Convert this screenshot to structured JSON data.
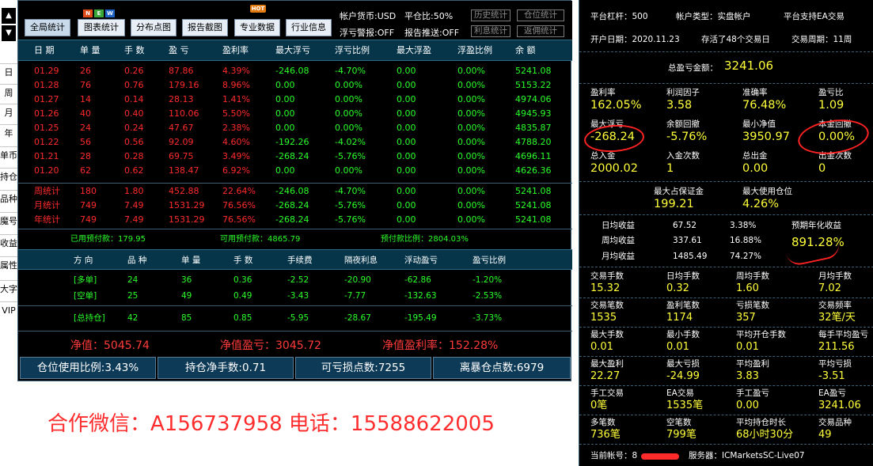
{
  "nav": {
    "up": "▲",
    "down": "▼",
    "items": [
      "日",
      "周",
      "月",
      "年",
      "单币",
      "持仓",
      "品种",
      "魔号",
      "收益",
      "属性",
      "大字",
      "VIP"
    ]
  },
  "toolbar": {
    "buttons": [
      "全局统计",
      "图表统计",
      "分布点图",
      "报告截图",
      "专业数据",
      "行业信息"
    ],
    "badge_new": [
      "N",
      "E",
      "W"
    ],
    "badge_hot": "HOT",
    "account_currency_label": "帐户货币:USD",
    "ratio_label": "平仓比:50%",
    "float_alarm": "浮亏警报:OFF",
    "report_push": "报告推送:OFF",
    "small_buttons": [
      "历史统计",
      "仓位统计",
      "利息统计",
      "返佣统计"
    ]
  },
  "table1": {
    "headers": [
      "日 期",
      "单 量",
      "手 数",
      "盈 亏",
      "盈利率",
      "最大浮亏",
      "浮亏比例",
      "最大浮盈",
      "浮盈比例",
      "余 额"
    ],
    "rows": [
      [
        "01.29",
        "26",
        "0.26",
        "87.86",
        "4.39%",
        "-246.08",
        "-4.70%",
        "0.00",
        "0.00%",
        "5241.08"
      ],
      [
        "01.28",
        "76",
        "0.76",
        "179.16",
        "8.96%",
        "0.00",
        "0.00%",
        "0.00",
        "0.00%",
        "5153.22"
      ],
      [
        "01.27",
        "14",
        "0.14",
        "28.13",
        "1.41%",
        "0.00",
        "0.00%",
        "0.00",
        "0.00%",
        "4974.06"
      ],
      [
        "01.26",
        "40",
        "0.40",
        "110.06",
        "5.50%",
        "0.00",
        "0.00%",
        "0.00",
        "0.00%",
        "4945.93"
      ],
      [
        "01.25",
        "24",
        "0.24",
        "47.67",
        "2.38%",
        "0.00",
        "0.00%",
        "0.00",
        "0.00%",
        "4835.87"
      ],
      [
        "01.22",
        "56",
        "0.56",
        "92.09",
        "4.60%",
        "-192.26",
        "-4.02%",
        "0.00",
        "0.00%",
        "4788.20"
      ],
      [
        "01.21",
        "28",
        "0.28",
        "69.75",
        "3.49%",
        "-268.24",
        "-5.76%",
        "0.00",
        "0.00%",
        "4696.11"
      ],
      [
        "01.20",
        "62",
        "0.62",
        "138.47",
        "6.92%",
        "0.00",
        "0.00%",
        "0.00",
        "0.00%",
        "4626.36"
      ]
    ],
    "summary": [
      [
        "周统计",
        "180",
        "1.80",
        "452.88",
        "22.64%",
        "-246.08",
        "-4.70%",
        "0.00",
        "0.00%",
        "5241.08"
      ],
      [
        "月统计",
        "749",
        "7.49",
        "1531.29",
        "76.56%",
        "-268.24",
        "-5.76%",
        "0.00",
        "0.00%",
        "5241.08"
      ],
      [
        "年统计",
        "749",
        "7.49",
        "1531.29",
        "76.56%",
        "-268.24",
        "-5.76%",
        "0.00",
        "0.00%",
        "5241.08"
      ]
    ]
  },
  "margin": {
    "used": "已用预付款：179.95",
    "available": "可用预付款：4865.79",
    "ratio": "预付款比例：2804.03%"
  },
  "table2": {
    "headers": [
      "方 向",
      "品 种",
      "单 量",
      "手 数",
      "手续费",
      "隔夜利息",
      "浮动盈亏",
      "盈亏比例"
    ],
    "rows": [
      [
        "[多单]",
        "24",
        "36",
        "0.36",
        "-2.52",
        "-20.90",
        "-62.86",
        "-1.20%"
      ],
      [
        "[空单]",
        "25",
        "49",
        "0.49",
        "-3.43",
        "-7.77",
        "-132.63",
        "-2.53%"
      ],
      [
        "[总持仓]",
        "42",
        "85",
        "0.85",
        "-5.95",
        "-28.67",
        "-195.49",
        "-3.73%"
      ]
    ]
  },
  "net": {
    "equity": "净值：5045.74",
    "equity_pl": "净值盈亏：3045.72",
    "equity_rate": "净值盈利率：152.28%"
  },
  "bottom": [
    "仓位使用比例:3.43%",
    "持仓净手数:0.71",
    "可亏损点数:7255",
    "离暴仓点数:6979"
  ],
  "contact": "合作微信：A156737958  电话：15588622005",
  "right": {
    "leverage": "平台杠杆：500",
    "acct_type": "帐户类型：实盘帐户",
    "ea_support": "平台支持EA交易",
    "open_date": "开户日期：2020.11.23",
    "survived": "存活了48个交易日",
    "cycle": "交易周期：11周",
    "total_pl_label": "总盈亏金额：",
    "total_pl": "3241.06",
    "grid1": [
      {
        "label": "盈利率",
        "value": "162.05%"
      },
      {
        "label": "利润因子",
        "value": "3.58"
      },
      {
        "label": "准确率",
        "value": "76.48%"
      },
      {
        "label": "盈亏比",
        "value": "1.09"
      },
      {
        "label": "最大浮亏",
        "value": "-268.24"
      },
      {
        "label": "余额回撤",
        "value": "-5.76%"
      },
      {
        "label": "最小净值",
        "value": "3950.97"
      },
      {
        "label": "本金回撤",
        "value": "0.00%"
      },
      {
        "label": "总入金",
        "value": "2000.02"
      },
      {
        "label": "入金次数",
        "value": "1"
      },
      {
        "label": "总出金",
        "value": "0.00"
      },
      {
        "label": "出金次数",
        "value": "0"
      }
    ],
    "margin_max_label": "最大占保证金",
    "margin_max": "199.21",
    "pos_max_label": "最大使用仓位",
    "pos_max": "4.26%",
    "daily_label": "日均收益",
    "daily_val": "67.52",
    "daily_pct": "3.38%",
    "weekly_label": "周均收益",
    "weekly_val": "337.61",
    "weekly_pct": "16.88%",
    "monthly_label": "月均收益",
    "monthly_val": "1485.49",
    "monthly_pct": "74.27%",
    "annual_label": "预期年化收益",
    "annual": "891.28%",
    "grid2": [
      {
        "label": "交易手数",
        "value": "15.32"
      },
      {
        "label": "日均手数",
        "value": "0.32"
      },
      {
        "label": "周均手数",
        "value": "1.60"
      },
      {
        "label": "月均手数",
        "value": "7.02"
      },
      {
        "label": "交易笔数",
        "value": "1535"
      },
      {
        "label": "盈利笔数",
        "value": "1174"
      },
      {
        "label": "亏损笔数",
        "value": "357"
      },
      {
        "label": "交易频率",
        "value": "32笔/天"
      },
      {
        "label": "最大手数",
        "value": "0.01"
      },
      {
        "label": "最小手数",
        "value": "0.01"
      },
      {
        "label": "平均开仓手数",
        "value": "0.01"
      },
      {
        "label": "每手平均盈亏",
        "value": "211.56"
      },
      {
        "label": "最大盈利",
        "value": "22.27"
      },
      {
        "label": "最大亏损",
        "value": "-24.99"
      },
      {
        "label": "平均盈利",
        "value": "3.83"
      },
      {
        "label": "平均亏损",
        "value": "-3.51"
      },
      {
        "label": "手工交易",
        "value": "0笔"
      },
      {
        "label": "EA交易",
        "value": "1535笔"
      },
      {
        "label": "手工盈亏",
        "value": "0.00"
      },
      {
        "label": "EA盈亏",
        "value": "3241.06"
      },
      {
        "label": "多笔数",
        "value": "736笔"
      },
      {
        "label": "空笔数",
        "value": "799笔"
      },
      {
        "label": "平均持仓时长",
        "value": "68小时30分"
      },
      {
        "label": "交易品种",
        "value": "49"
      }
    ],
    "current_acct": "当前帐号：8",
    "server": "服务器：ICMarketsSC-Live07"
  },
  "colors": {
    "accent_red": "#ff2b2b",
    "accent_green": "#2aff2a",
    "accent_yellow": "#ffff3a",
    "header_blue": "#063549"
  }
}
